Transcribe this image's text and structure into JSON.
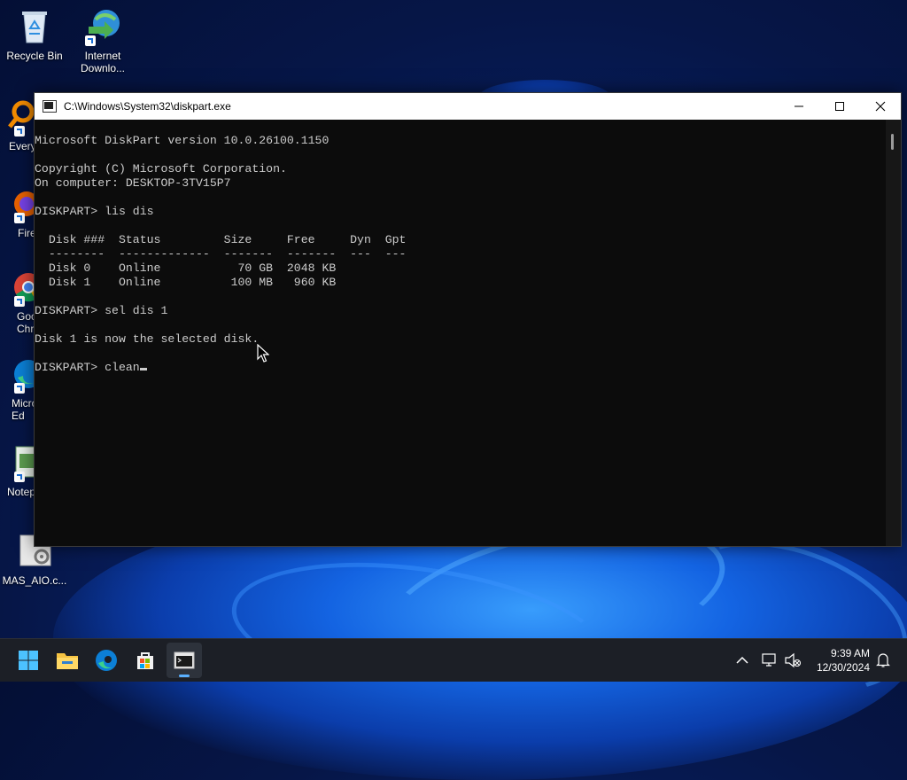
{
  "desktop": {
    "icons": [
      {
        "label": "Recycle Bin"
      },
      {
        "label": "Internet\nDownlo..."
      },
      {
        "label": "Every"
      },
      {
        "label": "Fire"
      },
      {
        "label": "Goo\nChro"
      },
      {
        "label": "Micro\nEd"
      },
      {
        "label": "Notep"
      },
      {
        "label": "MAS_AIO.c..."
      }
    ]
  },
  "window": {
    "title": "C:\\Windows\\System32\\diskpart.exe",
    "controls": {
      "minimize": "—",
      "maximize": "☐",
      "close": "✕"
    },
    "console": {
      "lines": [
        "Microsoft DiskPart version 10.0.26100.1150",
        "",
        "Copyright (C) Microsoft Corporation.",
        "On computer: DESKTOP-3TV15P7",
        "",
        "DISKPART> lis dis",
        "",
        "  Disk ###  Status         Size     Free     Dyn  Gpt",
        "  --------  -------------  -------  -------  ---  ---",
        "  Disk 0    Online           70 GB  2048 KB",
        "  Disk 1    Online          100 MB   960 KB",
        "",
        "DISKPART> sel dis 1",
        "",
        "Disk 1 is now the selected disk.",
        ""
      ],
      "prompt": "DISKPART> ",
      "current_input": "clean"
    }
  },
  "taskbar": {
    "apps": [
      {
        "name": "Start",
        "icon": "windows-logo-icon"
      },
      {
        "name": "File Explorer",
        "icon": "folder-icon"
      },
      {
        "name": "Microsoft Edge",
        "icon": "edge-icon"
      },
      {
        "name": "Microsoft Store",
        "icon": "store-icon"
      },
      {
        "name": "diskpart.exe",
        "icon": "console-icon",
        "active": true
      }
    ],
    "tray": {
      "time": "9:39 AM",
      "date": "12/30/2024"
    }
  }
}
